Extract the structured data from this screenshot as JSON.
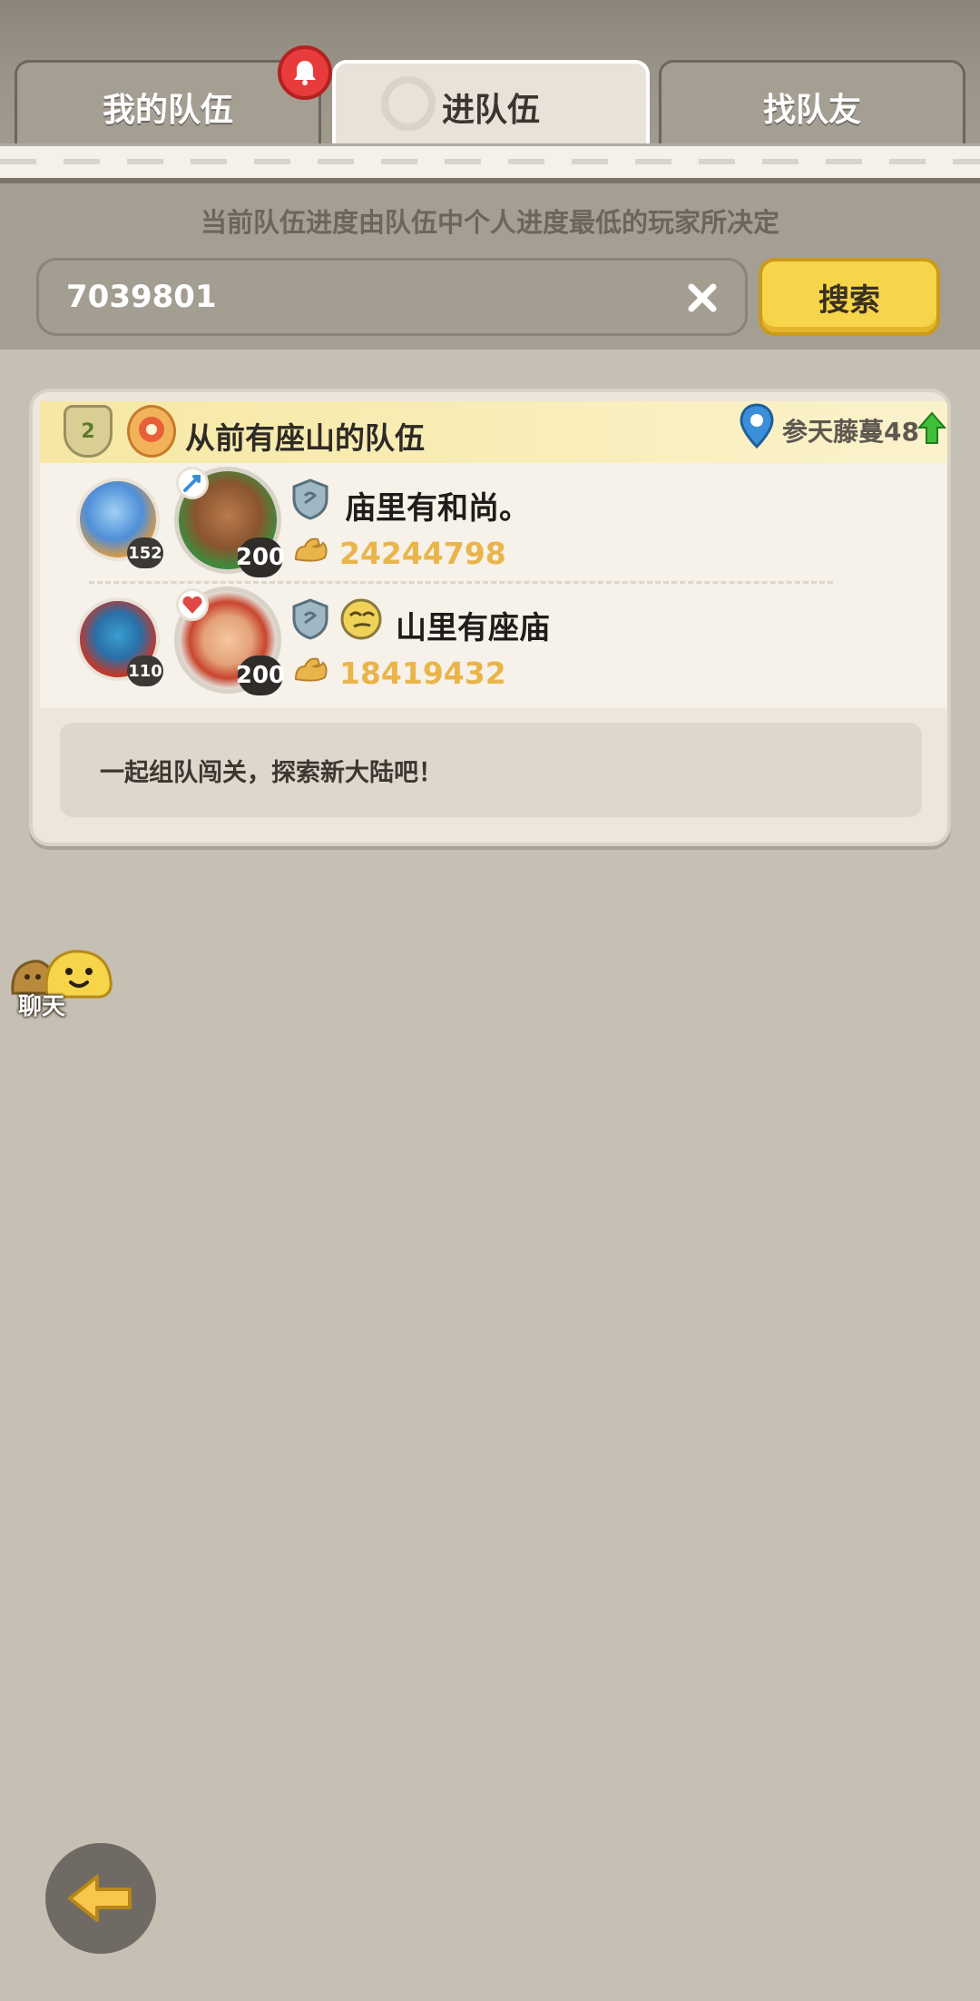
{
  "tabs": [
    {
      "label": "我的队伍",
      "active": false
    },
    {
      "label": "进队伍",
      "active": true
    },
    {
      "label": "找队友",
      "active": false
    }
  ],
  "hint": "当前队伍进度由队伍中个人进度最低的玩家所决定",
  "search": {
    "value": "7039801",
    "button_label": "搜索"
  },
  "team": {
    "rank_badge": "2",
    "name": "从前有座山的队伍",
    "location": "参天藤蔓48",
    "members": [
      {
        "pet_level": "152",
        "player_level": "200",
        "name": "庙里有和尚。",
        "power": "24244798"
      },
      {
        "pet_level": "110",
        "player_level": "200",
        "name": "山里有座庙",
        "power": "18419432"
      }
    ],
    "slogan": "一起组队闯关，探索新大陆吧！"
  },
  "chat": {
    "label": "聊天"
  },
  "colors": {
    "accent_yellow": "#f7d54a",
    "power_gold": "#e9b54a",
    "notification_red": "#e83b3b",
    "location_blue": "#3b8fd9",
    "up_green": "#3fbf3a"
  }
}
